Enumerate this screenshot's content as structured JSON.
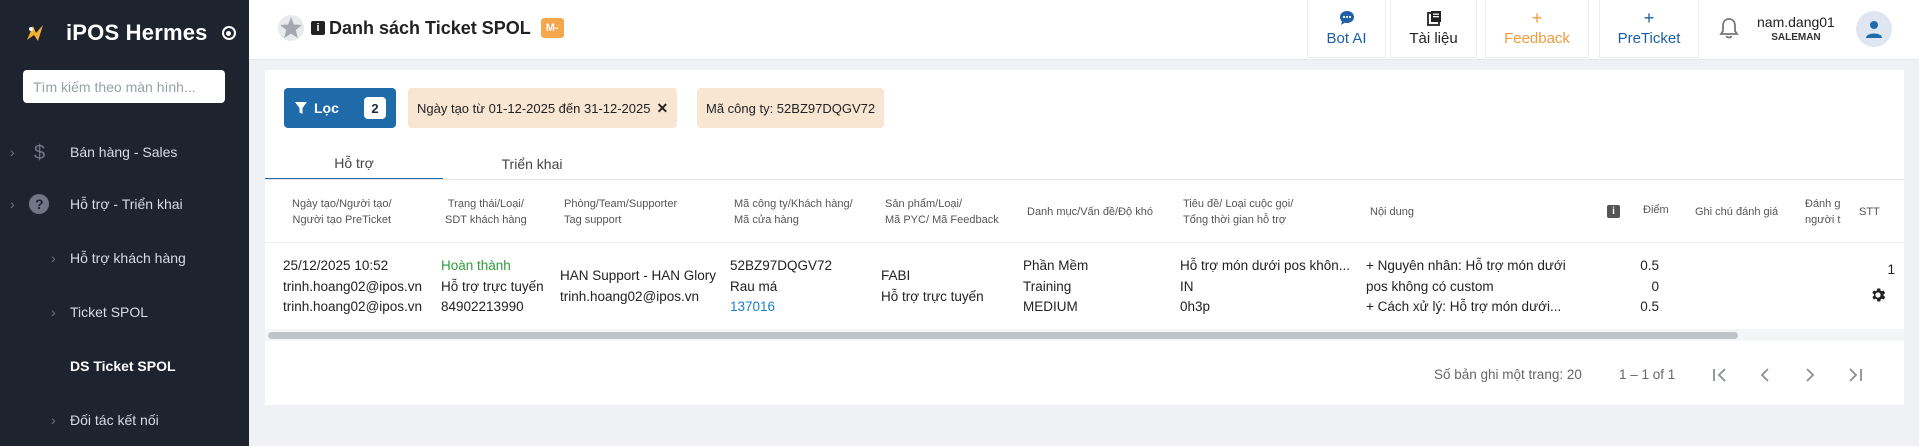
{
  "app": {
    "name": "iPOS Hermes"
  },
  "sidebar": {
    "search_placeholder": "Tìm kiếm theo màn hình...",
    "items": [
      {
        "label": "Bán hàng - Sales",
        "icon": "dollar-icon"
      },
      {
        "label": "Hỗ trợ - Triển khai",
        "icon": "help-circle-icon"
      },
      {
        "label": "Hỗ trợ khách hàng"
      },
      {
        "label": "Ticket SPOL"
      },
      {
        "label": "DS Ticket SPOL"
      },
      {
        "label": "Đối tác kết nối"
      }
    ]
  },
  "header": {
    "title": "Danh sách Ticket SPOL",
    "badge": "M-",
    "buttons": [
      {
        "label": "Bot AI",
        "icon": "chat-icon",
        "color": "#1f5fa8"
      },
      {
        "label": "Tài liệu",
        "icon": "book-icon",
        "color": "#222222"
      },
      {
        "label": "Feedback",
        "icon": "plus-icon",
        "color": "#f29a3c"
      },
      {
        "label": "PreTicket",
        "icon": "plus-icon",
        "color": "#1f5fa8"
      }
    ],
    "user": {
      "name": "nam.dang01",
      "role": "SALEMAN"
    }
  },
  "filters": {
    "button_label": "Lọc",
    "count": "2",
    "chips": [
      {
        "text": "Ngày tạo từ 01-12-2025 đến 31-12-2025",
        "closable": true
      },
      {
        "text": "Mã công ty: 52BZ97DQGV72",
        "closable": false
      }
    ]
  },
  "tabs": [
    {
      "label": "Hỗ trợ",
      "active": true
    },
    {
      "label": "Triển khai",
      "active": false
    }
  ],
  "table": {
    "columns": [
      [
        "Ngày tạo/Người tạo/",
        "Người tạo PreTicket"
      ],
      [
        "Trạng thái/Loại/",
        "SDT khách hàng"
      ],
      [
        "Phòng/Team/Supporter",
        "Tag support"
      ],
      [
        "Mã công ty/Khách hàng/",
        "Mã cửa hàng"
      ],
      [
        "Sản phẩm/Loại/",
        "Mã PYC/ Mã Feedback"
      ],
      [
        "Danh mục/Vấn đề/Độ khó"
      ],
      [
        "Tiêu đề/ Loại cuộc gọi/",
        "Tổng thời gian hỗ trợ"
      ],
      [
        "Nội dung"
      ],
      [
        "Điểm"
      ],
      [
        "Ghi chú đánh giá"
      ],
      [
        "Đánh g",
        "người t"
      ],
      [
        "STT"
      ]
    ],
    "row": {
      "created": [
        "25/12/2025 10:52",
        "trinh.hoang02@ipos.vn",
        "trinh.hoang02@ipos.vn"
      ],
      "status": [
        "Hoàn thành",
        "Hỗ trợ trực tuyến",
        "84902213990"
      ],
      "team": [
        "HAN Support - HAN Glory",
        "trinh.hoang02@ipos.vn"
      ],
      "company": [
        "52BZ97DQGV72",
        "Rau má",
        "137016"
      ],
      "product": [
        "FABI",
        "Hỗ trợ trực tuyến"
      ],
      "category": [
        "Phần Mềm",
        "Training",
        "MEDIUM"
      ],
      "title": [
        "Hỗ trợ món dưới pos khôn...",
        "IN",
        "0h3p"
      ],
      "content": [
        "+ Nguyên nhân: Hỗ trợ món dưới",
        "pos không có custom",
        "+ Cách xử lý: Hỗ trợ món dưới..."
      ],
      "scores": [
        "0.5",
        "0",
        "0.5"
      ],
      "stt": "1"
    }
  },
  "pagination": {
    "page_size_label": "Số bản ghi một trang: 20",
    "range": "1 – 1 of 1"
  }
}
